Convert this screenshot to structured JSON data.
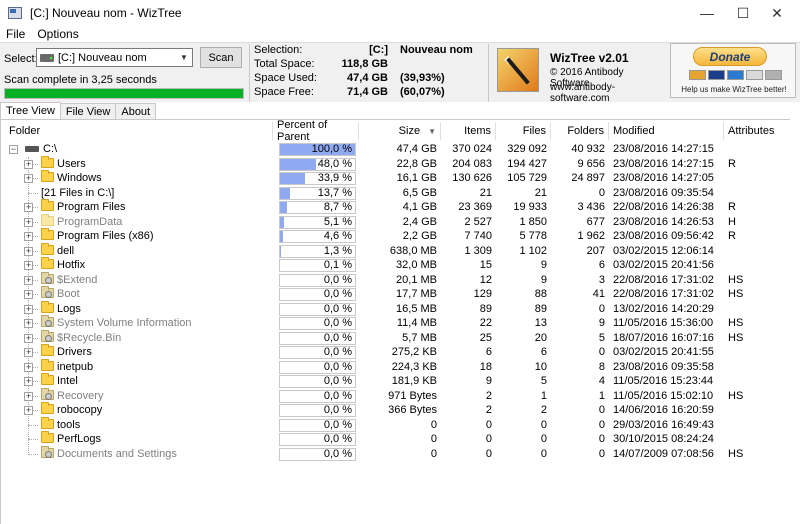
{
  "window": {
    "title": "[C:] Nouveau nom - WizTree"
  },
  "menu": [
    "File",
    "Options"
  ],
  "top": {
    "select_label": "Select:",
    "drive_value": "[C:] Nouveau nom",
    "scan_label": "Scan",
    "status": "Scan complete in 3,25 seconds",
    "progress": 1.0
  },
  "stats": {
    "selection_label": "Selection:",
    "selection_drive": "[C:]",
    "selection_name": "Nouveau nom",
    "total_label": "Total Space:",
    "total_value": "118,8 GB",
    "used_label": "Space Used:",
    "used_value": "47,4 GB",
    "used_pct": "(39,93%)",
    "free_label": "Space Free:",
    "free_value": "71,4 GB",
    "free_pct": "(60,07%)"
  },
  "about": {
    "name": "WizTree v2.01",
    "copyright": "© 2016 Antibody Software",
    "url": "www.antibody-software.com"
  },
  "donate": {
    "button": "Donate",
    "cards": [
      "#e8a430",
      "#1a3e8c",
      "#2a7ad0",
      "#d9d9d9",
      "#b0b0b0"
    ],
    "text": "Help us make WizTree better!"
  },
  "tabs": [
    "Tree View",
    "File View",
    "About"
  ],
  "columns": [
    "Folder",
    "Percent of Parent",
    "Size",
    "Items",
    "Files",
    "Folders",
    "Modified",
    "Attributes"
  ],
  "rows": [
    {
      "name": "C:\\",
      "type": "drive",
      "level": 0,
      "expander": "−",
      "pct": "100,0 %",
      "pctv": 100.0,
      "size": "47,4 GB",
      "items": "370 024",
      "files": "329 092",
      "folders": "40 932",
      "modified": "23/08/2016 14:27:15",
      "attr": ""
    },
    {
      "name": "Users",
      "type": "folder",
      "level": 1,
      "expander": "+",
      "pct": "48,0 %",
      "pctv": 48.0,
      "size": "22,8 GB",
      "items": "204 083",
      "files": "194 427",
      "folders": "9 656",
      "modified": "23/08/2016 14:27:15",
      "attr": "R"
    },
    {
      "name": "Windows",
      "type": "folder",
      "level": 1,
      "expander": "+",
      "pct": "33,9 %",
      "pctv": 33.9,
      "size": "16,1 GB",
      "items": "130 626",
      "files": "105 729",
      "folders": "24 897",
      "modified": "23/08/2016 14:27:05",
      "attr": ""
    },
    {
      "name": "[21 Files in C:\\]",
      "type": "files",
      "level": 1,
      "expander": "",
      "pct": "13,7 %",
      "pctv": 13.7,
      "size": "6,5 GB",
      "items": "21",
      "files": "21",
      "folders": "0",
      "modified": "23/08/2016 09:35:54",
      "attr": ""
    },
    {
      "name": "Program Files",
      "type": "folder",
      "level": 1,
      "expander": "+",
      "pct": "8,7 %",
      "pctv": 8.7,
      "size": "4,1 GB",
      "items": "23 369",
      "files": "19 933",
      "folders": "3 436",
      "modified": "22/08/2016 14:26:38",
      "attr": "R"
    },
    {
      "name": "ProgramData",
      "type": "dim",
      "level": 1,
      "expander": "+",
      "pct": "5,1 %",
      "pctv": 5.1,
      "size": "2,4 GB",
      "items": "2 527",
      "files": "1 850",
      "folders": "677",
      "modified": "23/08/2016 14:26:53",
      "attr": "H"
    },
    {
      "name": "Program Files (x86)",
      "type": "folder",
      "level": 1,
      "expander": "+",
      "pct": "4,6 %",
      "pctv": 4.6,
      "size": "2,2 GB",
      "items": "7 740",
      "files": "5 778",
      "folders": "1 962",
      "modified": "23/08/2016 09:56:42",
      "attr": "R"
    },
    {
      "name": "dell",
      "type": "folder",
      "level": 1,
      "expander": "+",
      "pct": "1,3 %",
      "pctv": 1.3,
      "size": "638,0 MB",
      "items": "1 309",
      "files": "1 102",
      "folders": "207",
      "modified": "03/02/2015 12:06:14",
      "attr": ""
    },
    {
      "name": "Hotfix",
      "type": "folder",
      "level": 1,
      "expander": "+",
      "pct": "0,1 %",
      "pctv": 0.1,
      "size": "32,0 MB",
      "items": "15",
      "files": "9",
      "folders": "6",
      "modified": "03/02/2015 20:41:56",
      "attr": ""
    },
    {
      "name": "$Extend",
      "type": "sys",
      "level": 1,
      "expander": "+",
      "pct": "0,0 %",
      "pctv": 0,
      "size": "20,1 MB",
      "items": "12",
      "files": "9",
      "folders": "3",
      "modified": "22/08/2016 17:31:02",
      "attr": "HS"
    },
    {
      "name": "Boot",
      "type": "sys",
      "level": 1,
      "expander": "+",
      "pct": "0,0 %",
      "pctv": 0,
      "size": "17,7 MB",
      "items": "129",
      "files": "88",
      "folders": "41",
      "modified": "22/08/2016 17:31:02",
      "attr": "HS"
    },
    {
      "name": "Logs",
      "type": "folder",
      "level": 1,
      "expander": "+",
      "pct": "0,0 %",
      "pctv": 0,
      "size": "16,5 MB",
      "items": "89",
      "files": "89",
      "folders": "0",
      "modified": "13/02/2016 14:20:29",
      "attr": ""
    },
    {
      "name": "System Volume Information",
      "type": "sys",
      "level": 1,
      "expander": "+",
      "pct": "0,0 %",
      "pctv": 0,
      "size": "11,4 MB",
      "items": "22",
      "files": "13",
      "folders": "9",
      "modified": "11/05/2016 15:36:00",
      "attr": "HS"
    },
    {
      "name": "$Recycle.Bin",
      "type": "sys",
      "level": 1,
      "expander": "+",
      "pct": "0,0 %",
      "pctv": 0,
      "size": "5,7 MB",
      "items": "25",
      "files": "20",
      "folders": "5",
      "modified": "18/07/2016 16:07:16",
      "attr": "HS"
    },
    {
      "name": "Drivers",
      "type": "folder",
      "level": 1,
      "expander": "+",
      "pct": "0,0 %",
      "pctv": 0,
      "size": "275,2 KB",
      "items": "6",
      "files": "6",
      "folders": "0",
      "modified": "03/02/2015 20:41:55",
      "attr": ""
    },
    {
      "name": "inetpub",
      "type": "folder",
      "level": 1,
      "expander": "+",
      "pct": "0,0 %",
      "pctv": 0,
      "size": "224,3 KB",
      "items": "18",
      "files": "10",
      "folders": "8",
      "modified": "23/08/2016 09:35:58",
      "attr": ""
    },
    {
      "name": "Intel",
      "type": "folder",
      "level": 1,
      "expander": "+",
      "pct": "0,0 %",
      "pctv": 0,
      "size": "181,9 KB",
      "items": "9",
      "files": "5",
      "folders": "4",
      "modified": "11/05/2016 15:23:44",
      "attr": ""
    },
    {
      "name": "Recovery",
      "type": "sys",
      "level": 1,
      "expander": "+",
      "pct": "0,0 %",
      "pctv": 0,
      "size": "971 Bytes",
      "items": "2",
      "files": "1",
      "folders": "1",
      "modified": "11/05/2016 15:02:10",
      "attr": "HS"
    },
    {
      "name": "robocopy",
      "type": "folder",
      "level": 1,
      "expander": "+",
      "pct": "0,0 %",
      "pctv": 0,
      "size": "366 Bytes",
      "items": "2",
      "files": "2",
      "folders": "0",
      "modified": "14/06/2016 16:20:59",
      "attr": ""
    },
    {
      "name": "tools",
      "type": "folder",
      "level": 1,
      "expander": "",
      "pct": "0,0 %",
      "pctv": 0,
      "size": "0",
      "items": "0",
      "files": "0",
      "folders": "0",
      "modified": "29/03/2016 16:49:43",
      "attr": ""
    },
    {
      "name": "PerfLogs",
      "type": "folder",
      "level": 1,
      "expander": "",
      "pct": "0,0 %",
      "pctv": 0,
      "size": "0",
      "items": "0",
      "files": "0",
      "folders": "0",
      "modified": "30/10/2015 08:24:24",
      "attr": ""
    },
    {
      "name": "Documents and Settings",
      "type": "sys",
      "level": 1,
      "expander": "",
      "pct": "0,0 %",
      "pctv": 0,
      "size": "0",
      "items": "0",
      "files": "0",
      "folders": "0",
      "modified": "14/07/2009 07:08:56",
      "attr": "HS"
    }
  ]
}
